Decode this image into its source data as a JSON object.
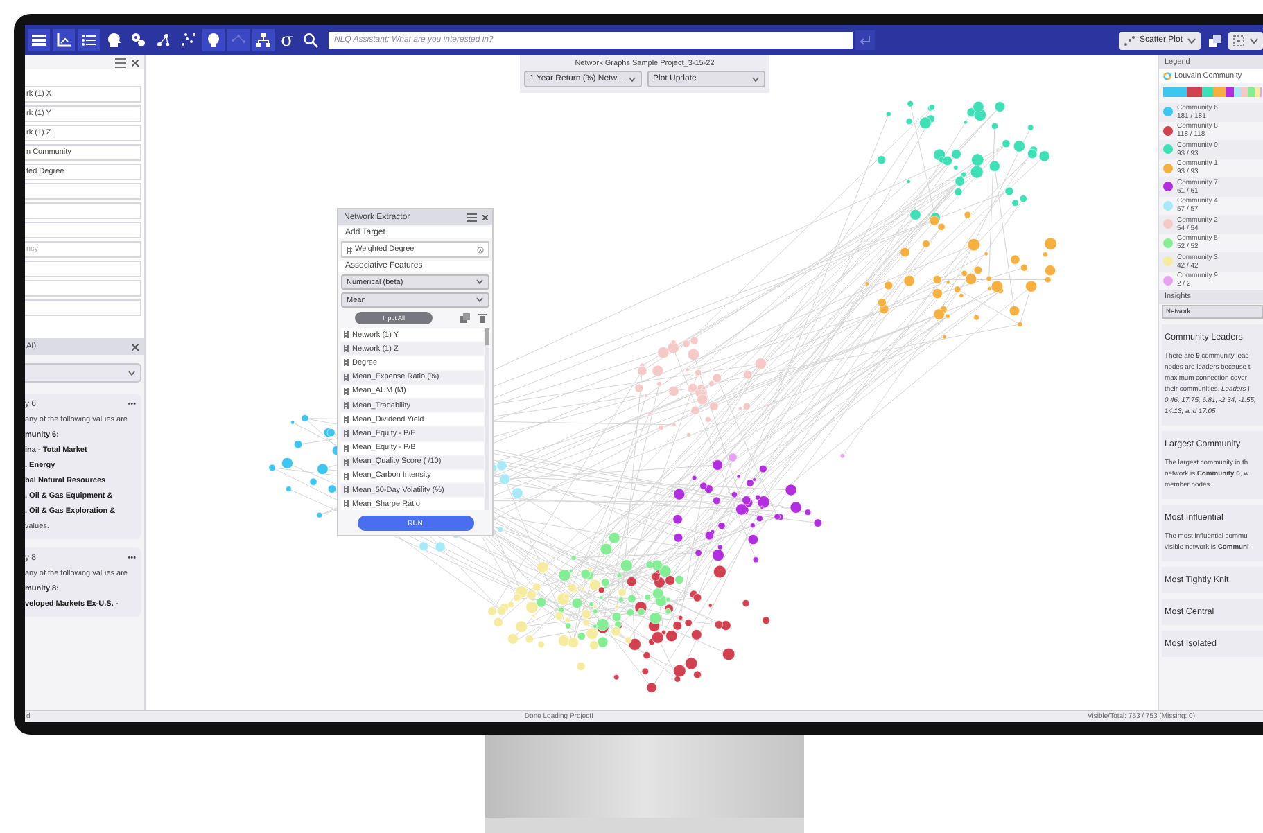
{
  "toolbar": {
    "sigma": "σ",
    "search": {
      "placeholder": "NLQ Assistant: What are you interested in?"
    },
    "chart_type": "Scatter Plot"
  },
  "left_panel": {
    "fields": [
      {
        "kind": "filled",
        "text": "rk (1) X"
      },
      {
        "kind": "filled",
        "text": "rk (1) Y"
      },
      {
        "kind": "filled",
        "text": "rk (1) Z"
      },
      {
        "kind": "filled",
        "text": "n Community"
      },
      {
        "kind": "filled",
        "text": "ted Degree"
      },
      {
        "kind": "blank"
      },
      {
        "kind": "blank"
      },
      {
        "kind": "blank"
      },
      {
        "kind": "hint",
        "text": "ncy"
      },
      {
        "kind": "blank"
      },
      {
        "kind": "blank"
      },
      {
        "kind": "blank"
      }
    ],
    "section_title": "AI)",
    "cards": [
      {
        "title": "y 6",
        "menu": "•••",
        "lines": [
          {
            "text": "any of the following values are",
            "bold": false
          },
          {
            "text": "munity 6:",
            "bold": true
          },
          {
            "text": "ina - Total Market",
            "bold": true
          },
          {
            "text": ". Energy",
            "bold": true
          },
          {
            "text": "bal Natural Resources",
            "bold": true
          },
          {
            "text": ". Oil & Gas Equipment &",
            "bold": true
          },
          {
            "text": ". Oil & Gas Exploration &",
            "bold": true
          },
          {
            "text": "values.",
            "bold": false
          }
        ]
      },
      {
        "title": "y 8",
        "menu": "•••",
        "lines": [
          {
            "text": "any of the following values are",
            "bold": false
          },
          {
            "text": "munity 8:",
            "bold": true
          },
          {
            "text": "veloped Markets Ex-U.S. -",
            "bold": true
          }
        ]
      }
    ]
  },
  "plot": {
    "project": "Network Graphs Sample Project_3-15-22",
    "dropdowns": [
      "1 Year Return (%) Netw...",
      "Plot Update"
    ]
  },
  "extractor": {
    "title": "Network Extractor",
    "add_target": "Add Target",
    "target": "Weighted Degree",
    "features_title": "Associative Features",
    "selects": [
      "Numerical (beta)",
      "Mean"
    ],
    "input_all": "Input All",
    "features": [
      "Network (1) Y",
      "Network (1) Z",
      "Degree",
      "Mean_Expense Ratio (%)",
      "Mean_AUM (M)",
      "Mean_Tradability",
      "Mean_Dividend Yield",
      "Mean_Equity - P/E",
      "Mean_Equity - P/B",
      "Mean_Quality Score ( /10)",
      "Mean_Carbon Intensity",
      "Mean_50-Day Volatility (%)",
      "Mean_Sharpe Ratio"
    ],
    "run": "RUN"
  },
  "legend": {
    "title": "Legend",
    "attribute": "Louvain Community",
    "communities": [
      {
        "name": "Community 6",
        "count": "181 / 181",
        "color": "#3cc6f0"
      },
      {
        "name": "Community 8",
        "count": "118 / 118",
        "color": "#d3404f"
      },
      {
        "name": "Community 0",
        "count": "93 / 93",
        "color": "#3ee0b6"
      },
      {
        "name": "Community 1",
        "count": "93 / 93",
        "color": "#f5b040"
      },
      {
        "name": "Community 7",
        "count": "61 / 61",
        "color": "#b22ee0"
      },
      {
        "name": "Community 4",
        "count": "57 / 57",
        "color": "#a6eaf8"
      },
      {
        "name": "Community 2",
        "count": "54 / 54",
        "color": "#f5c9c6"
      },
      {
        "name": "Community 5",
        "count": "52 / 52",
        "color": "#84ee94"
      },
      {
        "name": "Community 3",
        "count": "42 / 42",
        "color": "#f6eca0"
      },
      {
        "name": "Community 9",
        "count": "2 / 2",
        "color": "#e8a2f2"
      }
    ]
  },
  "insights": {
    "title": "Insights",
    "select": "Network",
    "cards": [
      {
        "title": "Community Leaders",
        "lines": [
          "There are **9** community lead",
          "nodes are leaders because t",
          "maximum connection cover",
          "their communities. *Leaders* i",
          "*0.46, 17.75, 6.81, -2.34, -1.55,*",
          "*14.13, and 17.05*"
        ]
      },
      {
        "title": "Largest Community",
        "lines": [
          "The largest community in th",
          "network is **Community 6**, w",
          "member nodes."
        ]
      },
      {
        "title": "Most Influential",
        "lines": [
          "The most influential commu",
          "visible network is **Communi**"
        ]
      },
      {
        "title": "Most Tightly Knit"
      },
      {
        "title": "Most Central"
      },
      {
        "title": "Most Isolated"
      }
    ]
  },
  "status_bar": {
    "left": "d",
    "center": "Done Loading Project!",
    "right": "Visible/Total: 753 / 753 (Missing: 0)"
  }
}
